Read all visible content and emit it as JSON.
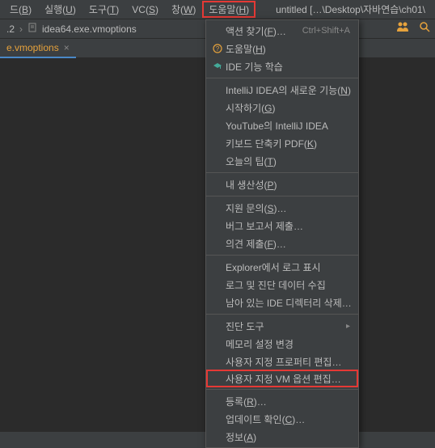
{
  "menubar": {
    "items": [
      {
        "prefix": "드",
        "mn": "B",
        "suffix": ""
      },
      {
        "prefix": "실행",
        "mn": "U",
        "suffix": ""
      },
      {
        "prefix": "도구",
        "mn": "T",
        "suffix": ""
      },
      {
        "prefix": "VC",
        "mn": "S",
        "suffix": ""
      },
      {
        "prefix": "창",
        "mn": "W",
        "suffix": ""
      },
      {
        "prefix": "도움말",
        "mn": "H",
        "suffix": ""
      }
    ],
    "title": "untitled  […\\Desktop\\자바연습\\ch01\\"
  },
  "breadcrumb": {
    "part1": ".2",
    "file": "idea64.exe.vmoptions"
  },
  "tab": {
    "name": "e.vmoptions",
    "close": "×"
  },
  "toolbar": {
    "users_icon": "users",
    "search_icon": "search"
  },
  "menu": {
    "find_action": {
      "label": "액션 찾기",
      "mn": "F",
      "shortcut": "Ctrl+Shift+A"
    },
    "help": {
      "label": "도움말",
      "mn": "H"
    },
    "learn_ide": {
      "label": "IDE 기능 학습"
    },
    "whats_new": {
      "label": "IntelliJ IDEA의 새로운 기능",
      "mn": "N"
    },
    "getting_started": {
      "label": "시작하기",
      "mn": "G"
    },
    "youtube": {
      "label": "YouTube의 IntelliJ IDEA"
    },
    "keyboard_pdf": {
      "label": "키보드 단축키 PDF",
      "mn": "K"
    },
    "tip_of_day": {
      "label": "오늘의 팁",
      "mn": "T"
    },
    "my_productivity": {
      "label": "내 생산성",
      "mn": "P"
    },
    "contact_support": {
      "label": "지원 문의",
      "mn": "S"
    },
    "submit_bug": {
      "label": "버그 보고서 제출…"
    },
    "submit_feedback": {
      "label": "의견 제출",
      "mn": "F"
    },
    "show_log": {
      "label": "Explorer에서 로그 표시"
    },
    "collect_logs": {
      "label": "로그 및 진단 데이터 수집"
    },
    "delete_dirs": {
      "label": "남아 있는 IDE 디렉터리 삭제…"
    },
    "diagnostic_tools": {
      "label": "진단 도구"
    },
    "change_memory": {
      "label": "메모리 설정 변경"
    },
    "edit_props": {
      "label": "사용자 지정 프로퍼티 편집…"
    },
    "edit_vm": {
      "label": "사용자 지정 VM 옵션 편집…"
    },
    "register": {
      "label": "등록",
      "mn": "R"
    },
    "check_updates": {
      "label": "업데이트 확인",
      "mn": "C"
    },
    "about": {
      "label": "정보",
      "mn": "A"
    }
  }
}
